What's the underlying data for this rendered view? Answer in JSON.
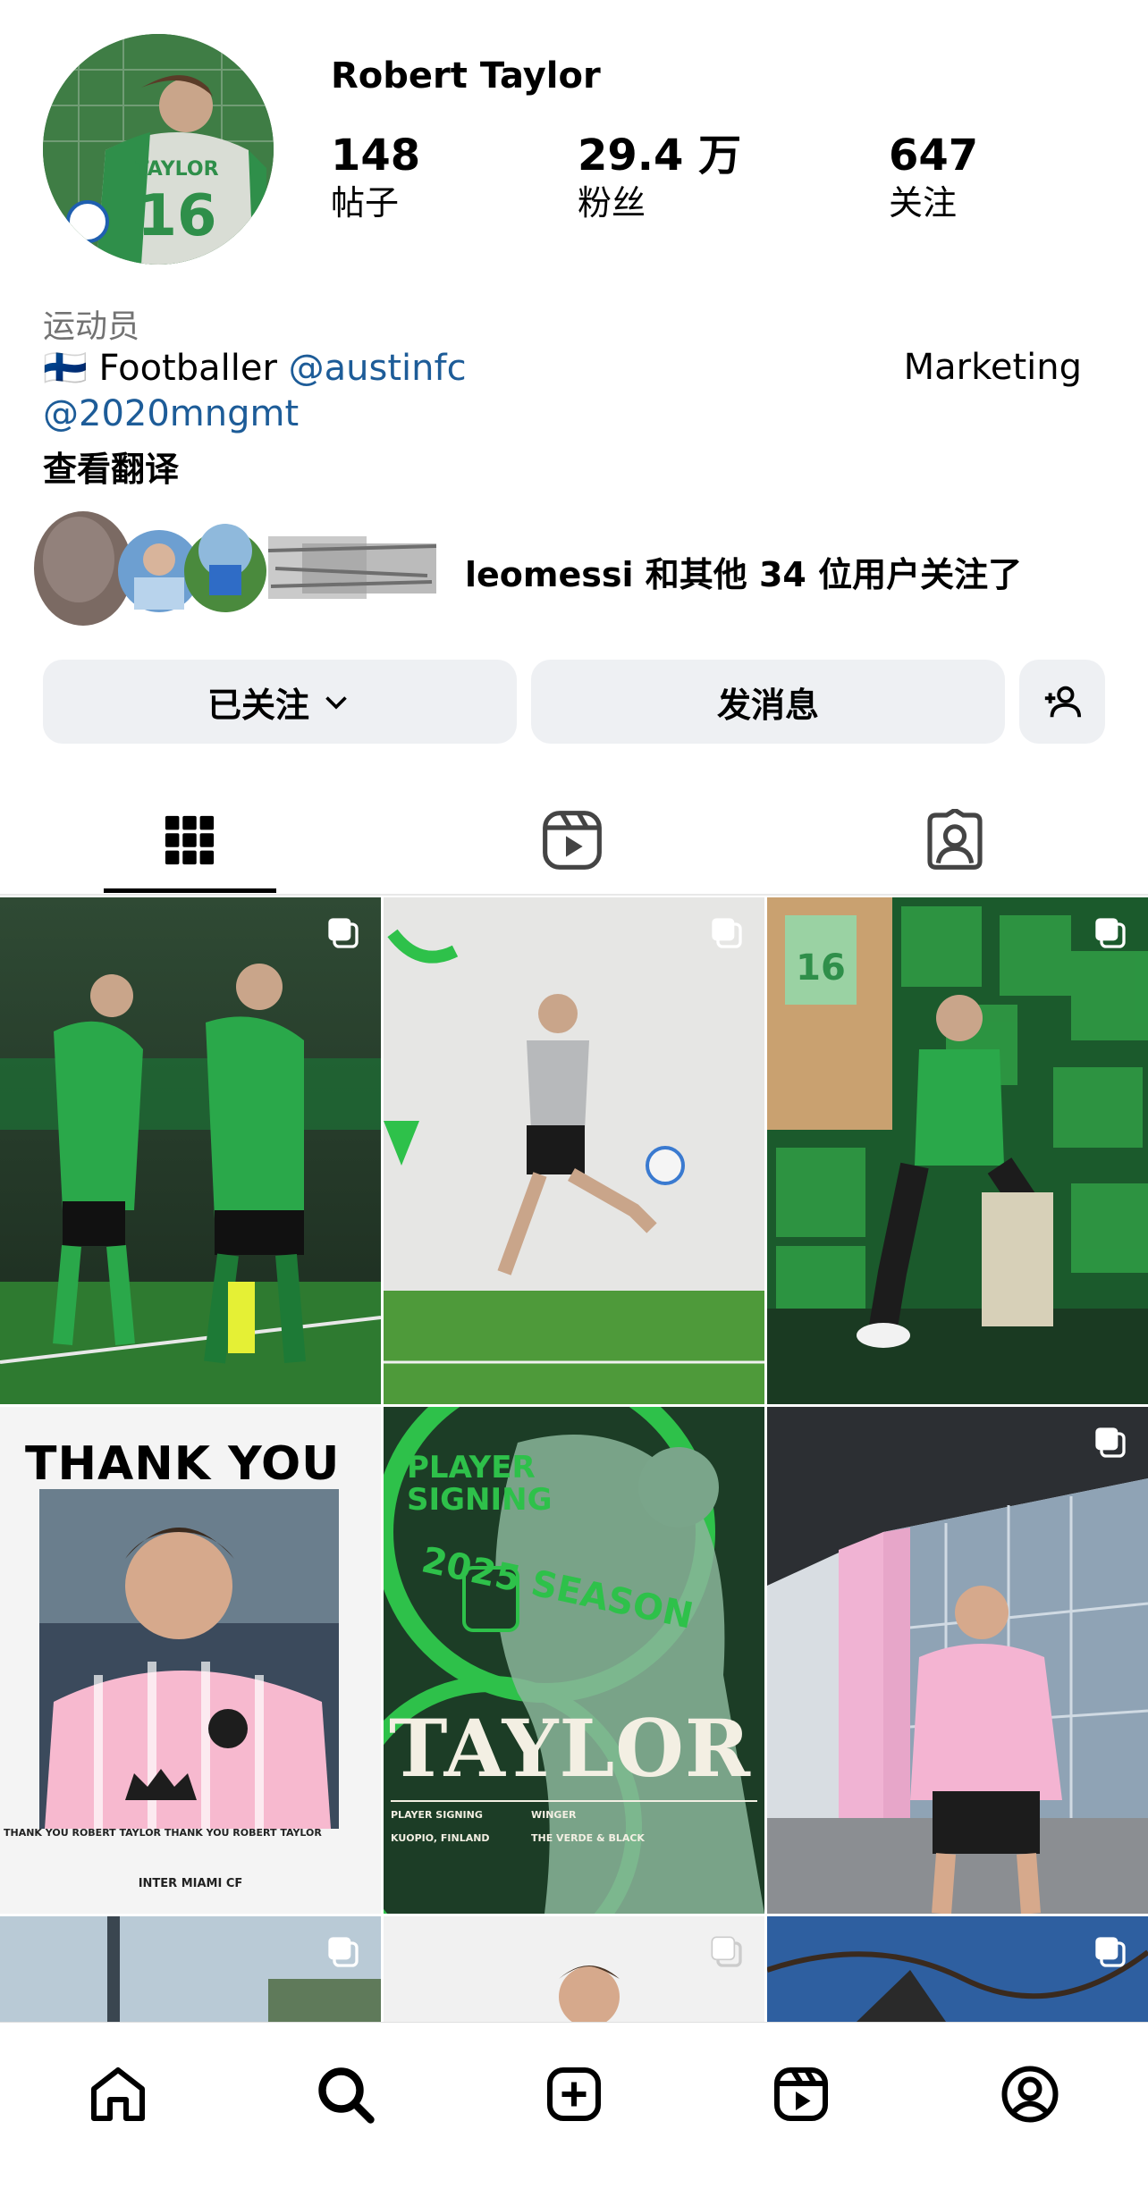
{
  "profile": {
    "name": "Robert Taylor",
    "jersey_name": "TAYLOR",
    "jersey_number": "16",
    "stats": [
      {
        "value": "148",
        "label": "帖子"
      },
      {
        "value": "29.4 万",
        "label": "粉丝"
      },
      {
        "value": "647",
        "label": "关注"
      }
    ],
    "category": "运动员",
    "bio_flag": "🇫🇮",
    "bio_text": "Footballer",
    "bio_mention": "@austinfc",
    "bio_right": "Marketing",
    "bio_mention2": "@2020mngmt",
    "translate": "查看翻译",
    "followed_by": "leomessi 和其他 34 位用户关注了"
  },
  "buttons": {
    "following": "已关注",
    "message": "发消息"
  },
  "posts": {
    "poster_thank_you": "THANK YOU",
    "poster_side_text": "THANK YOU ROBERT TAYLOR THANK YOU ROBERT TAYLOR",
    "poster_inter": "INTER MIAMI CF",
    "poster_taylor": "TAYLOR",
    "poster_signing": "PLAYER SIGNING",
    "poster_winger": "WINGER",
    "poster_kuopio": "KUOPIO, FINLAND",
    "poster_verde": "THE VERDE & BLACK",
    "poster_season": "2025 SEASON"
  },
  "colors": {
    "link": "#1d5c98",
    "button_bg": "#eef0f3",
    "austin_green": "#2e8b3e",
    "miami_pink": "#f2a7c3"
  },
  "icons": {
    "grid_tab": "grid-icon",
    "reels_tab": "reels-icon",
    "tagged_tab": "tagged-icon",
    "nav": [
      "home-icon",
      "search-icon",
      "create-icon",
      "reels-icon",
      "profile-icon"
    ]
  }
}
